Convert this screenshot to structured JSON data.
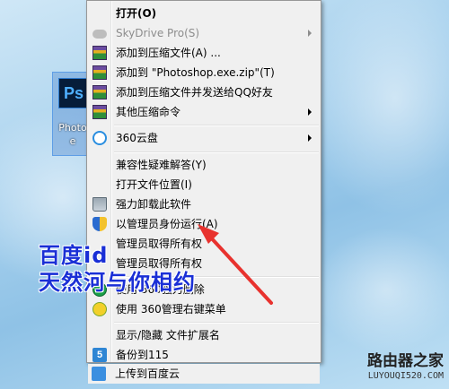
{
  "desktop_icon": {
    "tile_text": "Ps",
    "label": "Photo e"
  },
  "context_menu": {
    "items": [
      {
        "label": "打开(O)",
        "icon": "",
        "bold": true
      },
      {
        "label": "SkyDrive Pro(S)",
        "icon": "cloud-icon",
        "disabled": true,
        "submenu": true
      },
      {
        "label": "添加到压缩文件(A) ...",
        "icon": "winrar-icon"
      },
      {
        "label": "添加到 \"Photoshop.exe.zip\"(T)",
        "icon": "winrar-icon"
      },
      {
        "label": "添加到压缩文件并发送给QQ好友",
        "icon": "winrar-icon"
      },
      {
        "label": "其他压缩命令",
        "icon": "winrar-icon",
        "submenu": true
      },
      {
        "label": "360云盘",
        "icon": "360-cloud-icon",
        "submenu": true
      },
      {
        "label": "兼容性疑难解答(Y)",
        "icon": ""
      },
      {
        "label": "打开文件位置(I)",
        "icon": ""
      },
      {
        "label": "强力卸载此软件",
        "icon": "trash-icon"
      },
      {
        "label": "以管理员身份运行(A)",
        "icon": "uac-shield-icon"
      },
      {
        "label": "管理员取得所有权",
        "icon": ""
      },
      {
        "label": "管理员取得所有权",
        "icon": ""
      },
      {
        "label": "使用 360强力删除",
        "icon": "360-guard-icon"
      },
      {
        "label": "使用 360管理右键菜单",
        "icon": "360-plus-icon"
      },
      {
        "label": "显示/隐藏 文件扩展名",
        "icon": ""
      },
      {
        "label": "备份到115",
        "icon": "115-icon",
        "icon_text": "5"
      },
      {
        "label": "上传到百度云",
        "icon": "baidu-cloud-icon"
      }
    ]
  },
  "overlay": {
    "line1": "百度id",
    "line2": "天然河与你相约"
  },
  "watermark": {
    "title": "路由器之家",
    "url": "LUYOUQI520.COM"
  },
  "colors": {
    "overlay_text": "#1a2fd6",
    "arrow": "#e8322e",
    "menu_bg": "#f0f0f0"
  }
}
